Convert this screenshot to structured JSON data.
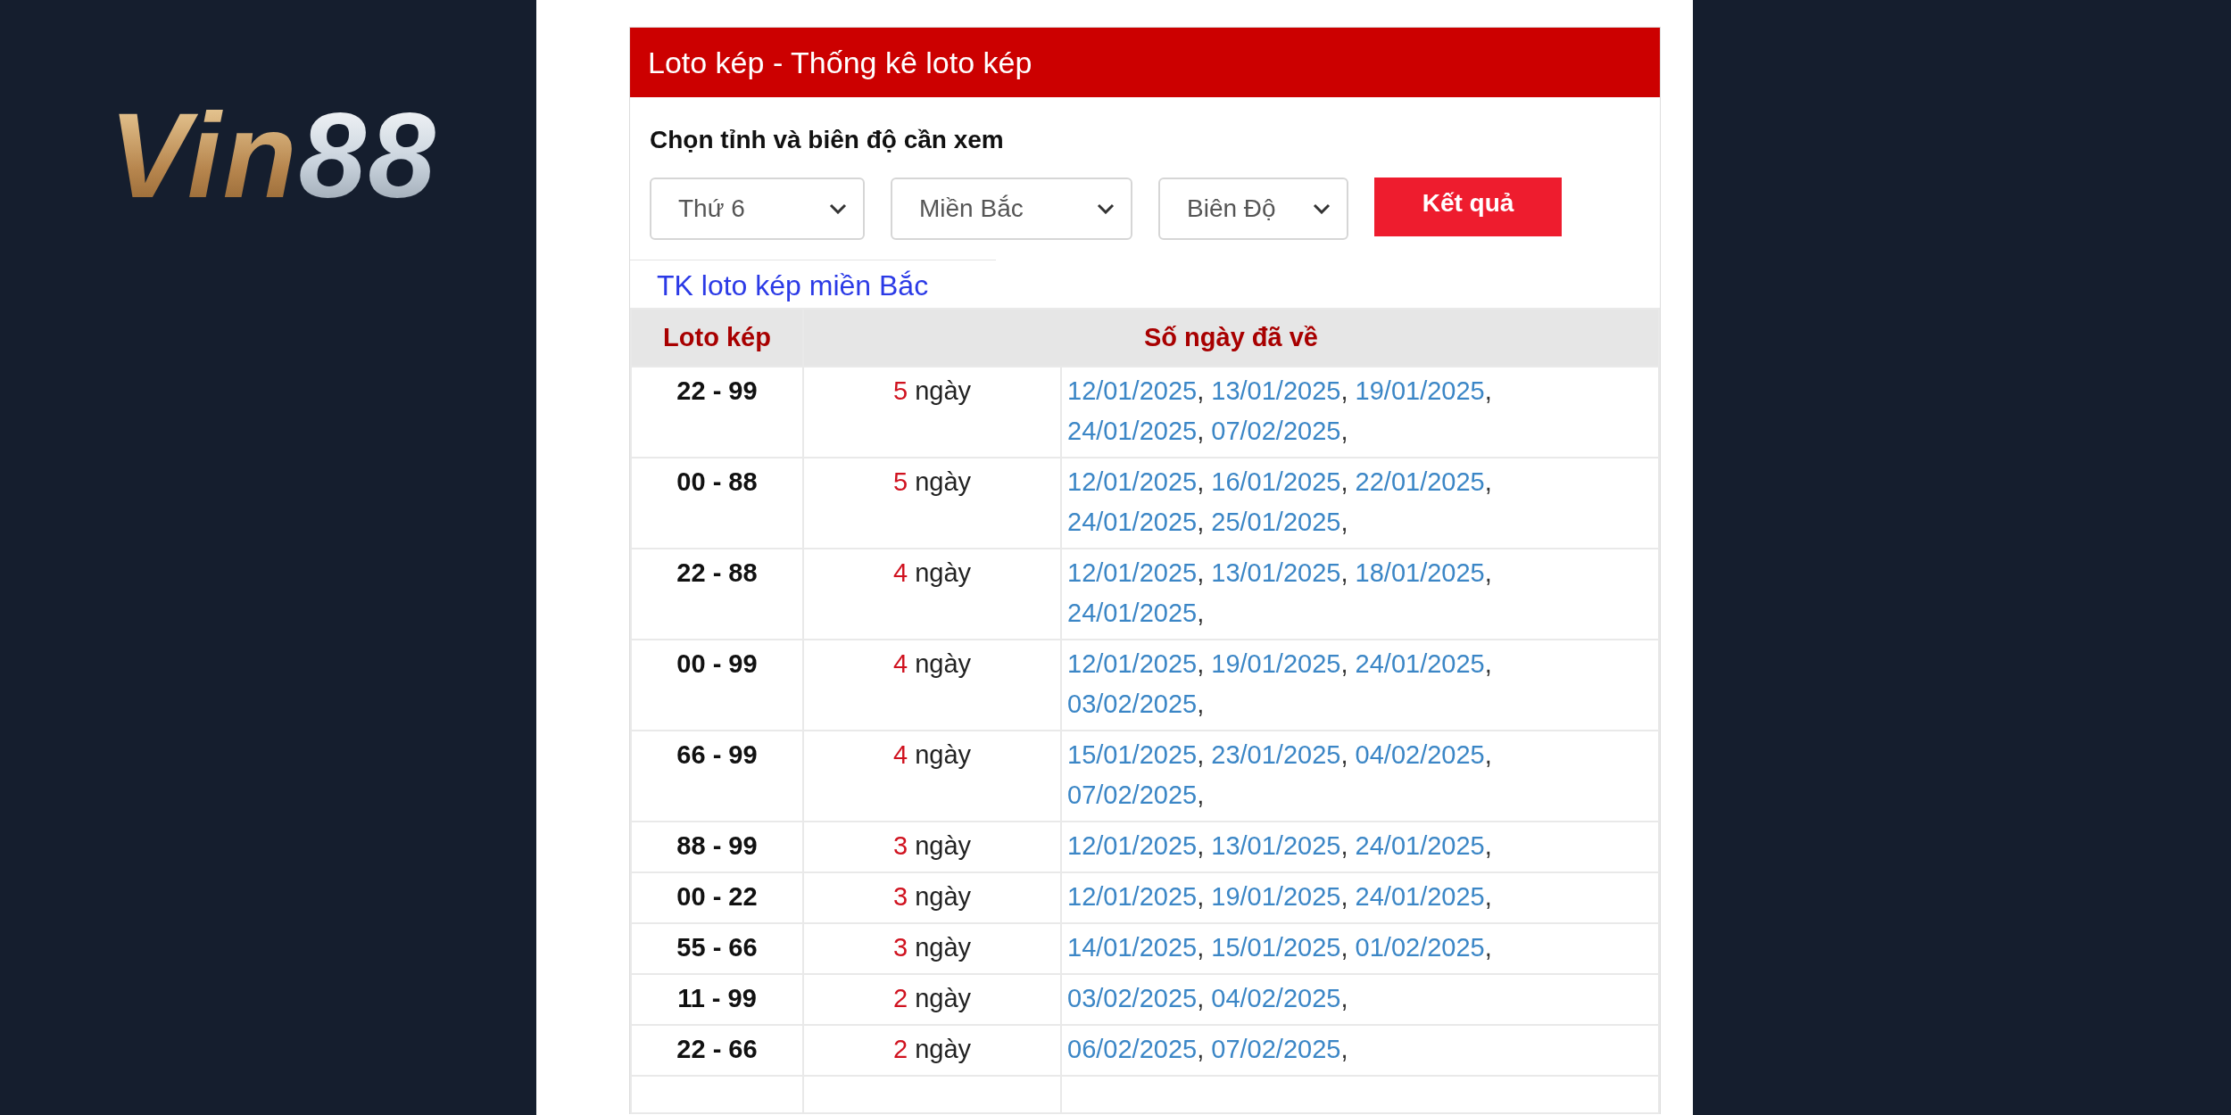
{
  "logo": {
    "part_1": "Vin",
    "part_2": "88"
  },
  "card": {
    "title": "Loto kép - Thống kê loto kép",
    "filter_label": "Chọn tỉnh và biên độ cần xem",
    "selects": [
      "Thứ 6",
      "Miền Bắc",
      "Biên Độ"
    ],
    "submit_button": "Kết quả",
    "link": "TK loto kép miền Bắc",
    "table": {
      "columns": [
        "Loto kép",
        "Số ngày đã về"
      ],
      "rows": [
        {
          "pair": "22 - 99",
          "count": "5",
          "unit": "ngày",
          "dates": [
            {
              "date": "12/01/2025",
              "separator": ","
            },
            {
              "date": "13/01/2025",
              "separator": ","
            },
            {
              "date": "19/01/2025",
              "separator": ","
            },
            {
              "date": "24/01/2025",
              "separator": ","
            },
            {
              "date": "07/02/2025",
              "separator": ","
            }
          ]
        },
        {
          "pair": "00 - 88",
          "count": "5",
          "unit": "ngày",
          "dates": [
            {
              "date": "12/01/2025",
              "separator": ","
            },
            {
              "date": "16/01/2025",
              "separator": ","
            },
            {
              "date": "22/01/2025",
              "separator": ","
            },
            {
              "date": "24/01/2025",
              "separator": ","
            },
            {
              "date": "25/01/2025",
              "separator": ","
            }
          ]
        },
        {
          "pair": "22 - 88",
          "count": "4",
          "unit": "ngày",
          "dates": [
            {
              "date": "12/01/2025",
              "separator": ","
            },
            {
              "date": "13/01/2025",
              "separator": ","
            },
            {
              "date": "18/01/2025",
              "separator": ","
            },
            {
              "date": "24/01/2025",
              "separator": ","
            }
          ]
        },
        {
          "pair": "00 - 99",
          "count": "4",
          "unit": "ngày",
          "dates": [
            {
              "date": "12/01/2025",
              "separator": ","
            },
            {
              "date": "19/01/2025",
              "separator": ","
            },
            {
              "date": "24/01/2025",
              "separator": ","
            },
            {
              "date": "03/02/2025",
              "separator": ","
            }
          ]
        },
        {
          "pair": "66 - 99",
          "count": "4",
          "unit": "ngày",
          "dates": [
            {
              "date": "15/01/2025",
              "separator": ","
            },
            {
              "date": "23/01/2025",
              "separator": ","
            },
            {
              "date": "04/02/2025",
              "separator": ","
            },
            {
              "date": "07/02/2025",
              "separator": ","
            }
          ]
        },
        {
          "pair": "88 - 99",
          "count": "3",
          "unit": "ngày",
          "dates": [
            {
              "date": "12/01/2025",
              "separator": ","
            },
            {
              "date": "13/01/2025",
              "separator": ","
            },
            {
              "date": "24/01/2025",
              "separator": ","
            }
          ]
        },
        {
          "pair": "00 - 22",
          "count": "3",
          "unit": "ngày",
          "dates": [
            {
              "date": "12/01/2025",
              "separator": ","
            },
            {
              "date": "19/01/2025",
              "separator": ","
            },
            {
              "date": "24/01/2025",
              "separator": ","
            }
          ]
        },
        {
          "pair": "55 - 66",
          "count": "3",
          "unit": "ngày",
          "dates": [
            {
              "date": "14/01/2025",
              "separator": ","
            },
            {
              "date": "15/01/2025",
              "separator": ","
            },
            {
              "date": "01/02/2025",
              "separator": ","
            }
          ]
        },
        {
          "pair": "11 - 99",
          "count": "2",
          "unit": "ngày",
          "dates": [
            {
              "date": "03/02/2025",
              "separator": ","
            },
            {
              "date": "04/02/2025",
              "separator": ","
            }
          ]
        },
        {
          "pair": "22 - 66",
          "count": "2",
          "unit": "ngày",
          "dates": [
            {
              "date": "06/02/2025",
              "separator": ","
            },
            {
              "date": "07/02/2025",
              "separator": ","
            }
          ]
        }
      ]
    }
  }
}
